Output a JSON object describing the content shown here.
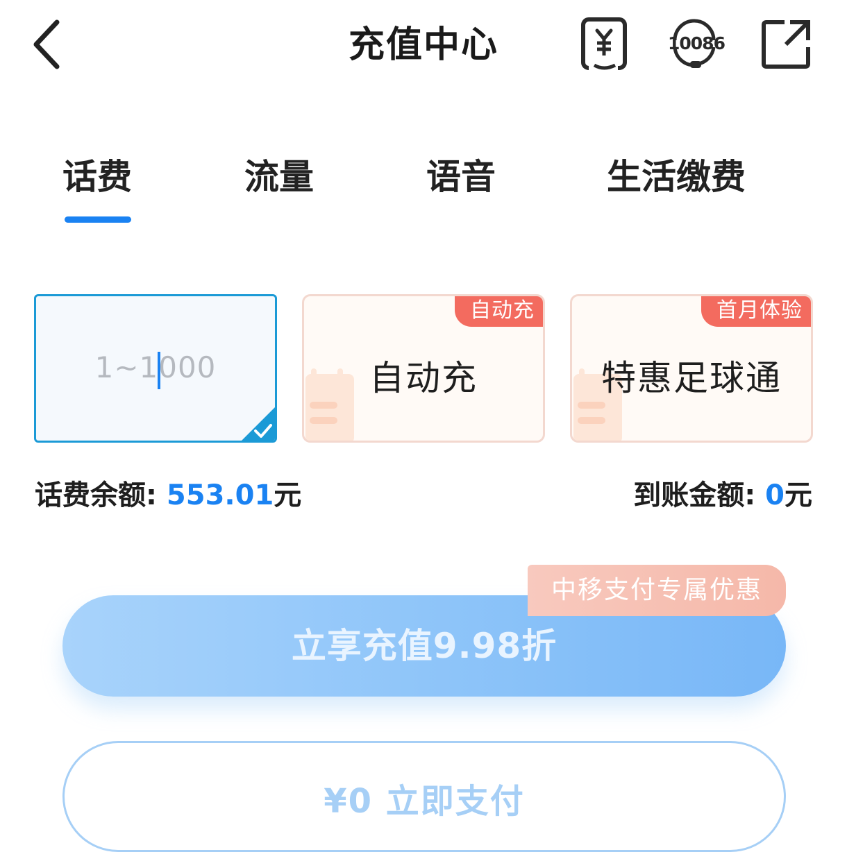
{
  "header": {
    "title": "充值中心",
    "icons": [
      "back-icon",
      "bill-icon",
      "customer-service-icon",
      "share-icon"
    ],
    "service_number": "10086"
  },
  "tabs": [
    {
      "label": "话费",
      "active": true
    },
    {
      "label": "流量",
      "active": false
    },
    {
      "label": "语音",
      "active": false
    },
    {
      "label": "生活缴费",
      "active": false
    }
  ],
  "amount_input": {
    "placeholder": "1~1000",
    "selected": true
  },
  "options": [
    {
      "label": "自动充",
      "tag": "自动充"
    },
    {
      "label": "特惠足球通",
      "tag": "首月体验"
    }
  ],
  "balance": {
    "label": "话费余额: ",
    "value": "553.01",
    "unit": "元"
  },
  "arrival": {
    "label": "到账金额: ",
    "value": "0",
    "unit": "元"
  },
  "promo": {
    "tag": "中移支付专属优惠",
    "button_label": "立享充值9.98折"
  },
  "pay": {
    "label": "¥0 立即支付"
  },
  "colors": {
    "accent": "#1a82f2",
    "tag_red": "#f36b5f",
    "button_light_blue": "#8fc5f9"
  }
}
